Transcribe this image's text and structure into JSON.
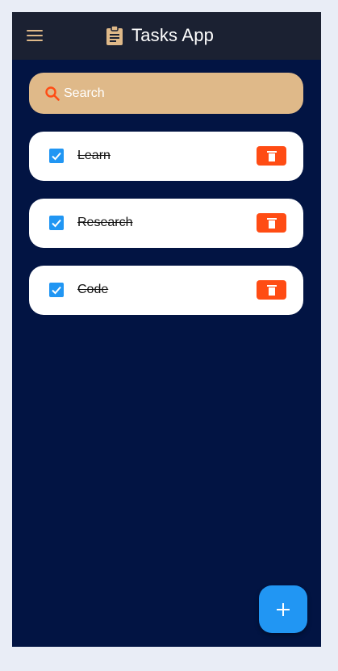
{
  "app": {
    "title": "Tasks App",
    "icons": {
      "menu": "menu-icon",
      "title": "clipboard-icon",
      "search": "search-icon",
      "delete": "trash-icon",
      "add": "plus-icon",
      "checkbox": "checkbox-checked-icon"
    }
  },
  "colors": {
    "accent": "#dfb989",
    "background": "#021443",
    "appbar": "#1b2132",
    "checkbox": "#2196f3",
    "delete": "#ff4c14",
    "fab": "#2196f3"
  },
  "search": {
    "placeholder": "Search",
    "value": ""
  },
  "tasks": [
    {
      "label": "Learn",
      "completed": true
    },
    {
      "label": "Research",
      "completed": true
    },
    {
      "label": "Code",
      "completed": true
    }
  ]
}
